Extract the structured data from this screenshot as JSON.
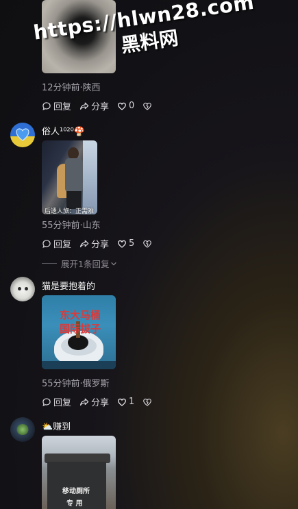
{
  "watermark": {
    "url": "https://hlwn28.com",
    "name": "黑料网"
  },
  "comments": [
    {
      "meta": "12分钟前·陕西",
      "reply_label": "回复",
      "share_label": "分享",
      "like_count": "0"
    },
    {
      "username": "俗人¹⁰²⁰🍄",
      "image_caption": "后遗人旅：正需难",
      "meta": "55分钟前·山东",
      "reply_label": "回复",
      "share_label": "分享",
      "like_count": "5",
      "expand_label": "展开1条回复"
    },
    {
      "username": "猫是要抱着的",
      "image_text_line1": "东大马桶",
      "image_text_line2": "国际拔子",
      "meta": "55分钟前·俄罗斯",
      "reply_label": "回复",
      "share_label": "分享",
      "like_count": "1"
    },
    {
      "username": "⛅赚到",
      "image_text_line1": "移动厕所",
      "image_text_line2": "专 用"
    }
  ],
  "colors": {
    "meta": "#a7a4ad",
    "text": "#f2f2f2",
    "accent_red": "#d93b3b"
  },
  "icons": [
    "comment-icon",
    "share-icon",
    "heart-icon",
    "dislike-heart-icon",
    "chevron-down-icon"
  ]
}
